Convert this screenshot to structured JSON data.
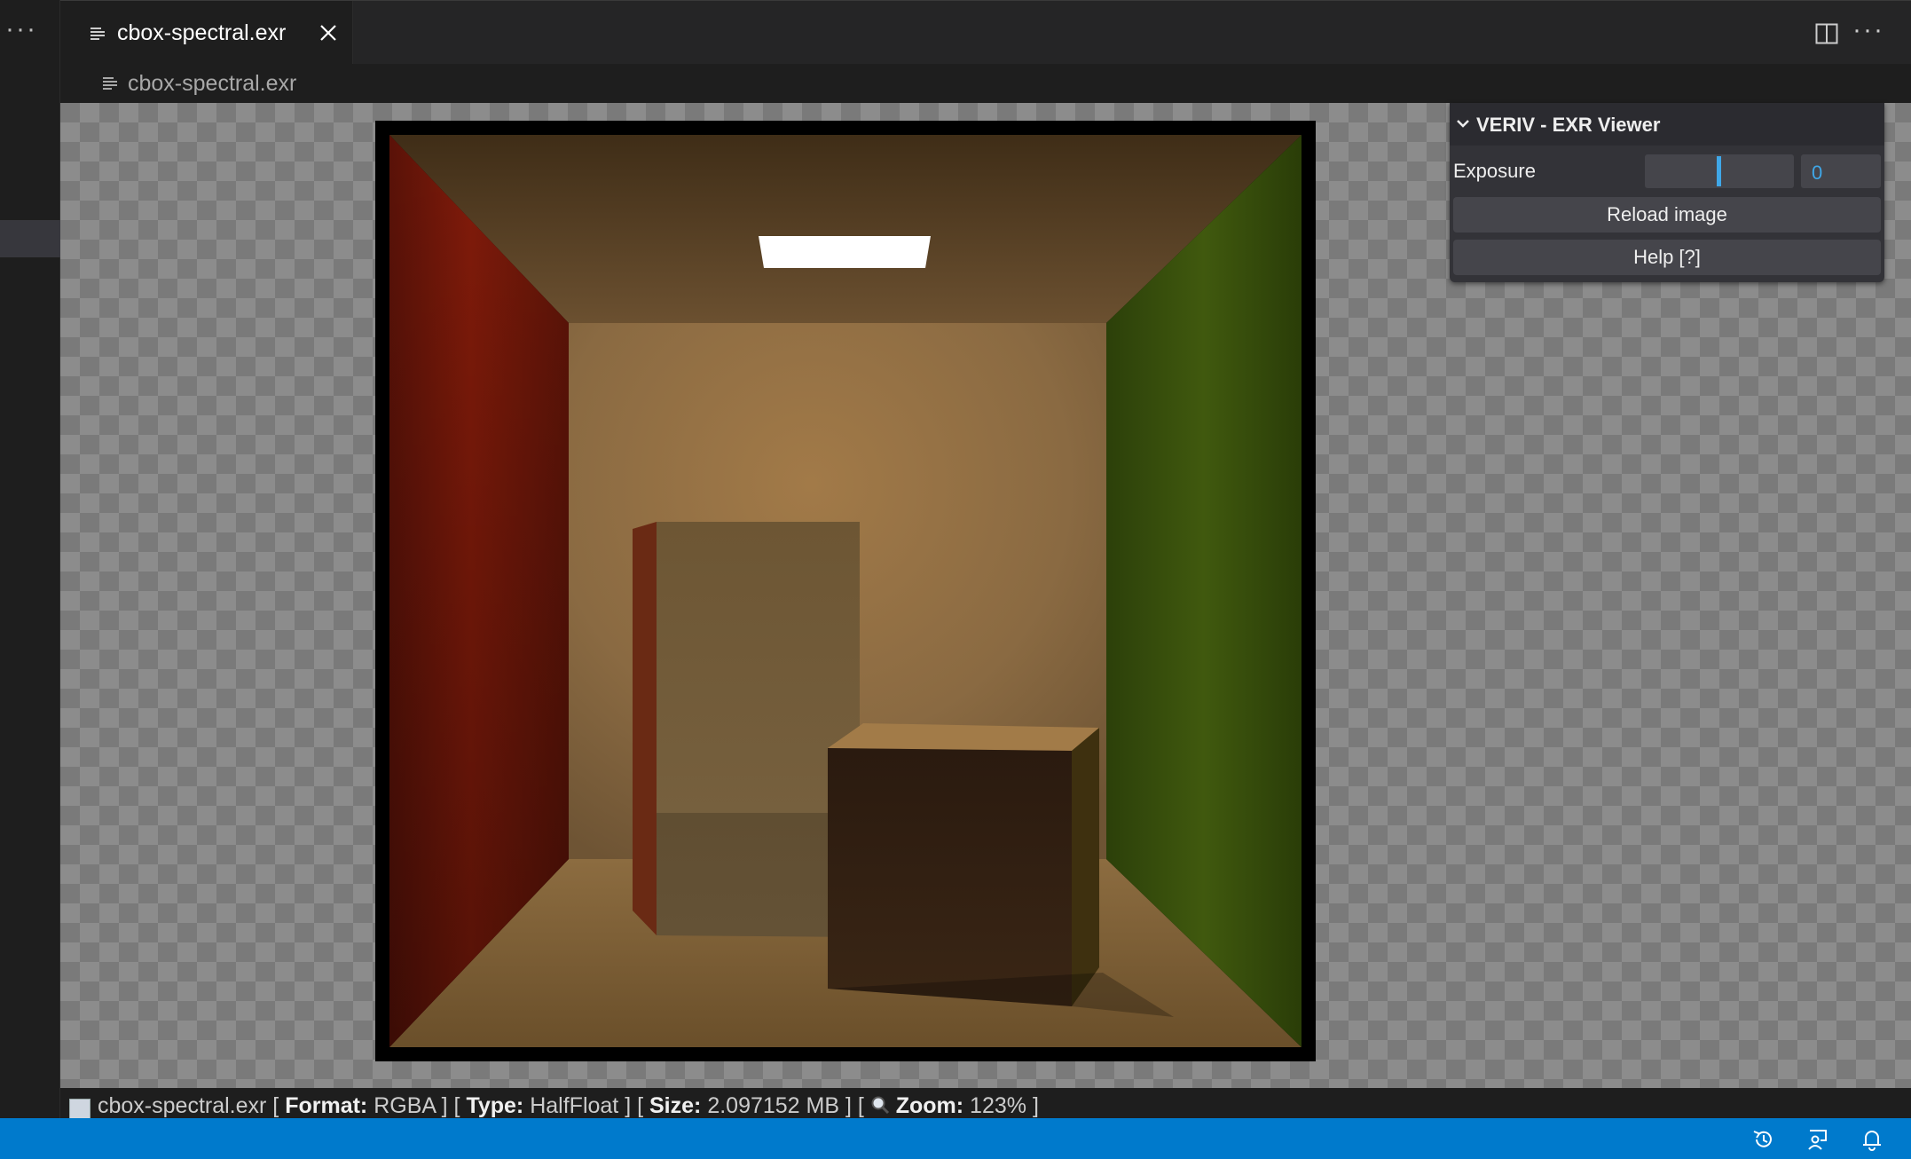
{
  "sidebar": {
    "more_label": "···"
  },
  "editor": {
    "tab_label": "cbox-spectral.exr",
    "more_label": "···",
    "breadcrumb": "cbox-spectral.exr"
  },
  "panel": {
    "title": "VERIV - EXR Viewer",
    "exposure_label": "Exposure",
    "exposure_value": "0",
    "reload_label": "Reload image",
    "help_label": "Help [?]"
  },
  "info": {
    "filename": "cbox-spectral.exr",
    "format_key": "Format:",
    "format_value": "RGBA",
    "type_key": "Type:",
    "type_value": "HalfFloat",
    "size_key": "Size:",
    "size_value": "2.097152 MB",
    "zoom_key": "Zoom:",
    "zoom_value": "123%"
  },
  "colors": {
    "statusbar": "#007acc",
    "accent": "#3fa7e8",
    "left_wall": "#7a1a0a",
    "right_wall": "#3f5a0c",
    "back_wall": "#9a7344"
  },
  "icons": [
    "file-icon",
    "close-icon",
    "split-editor-icon",
    "more-icon",
    "chevron-down-icon",
    "magnifier-icon",
    "history-icon",
    "remote-icon",
    "bell-icon"
  ]
}
